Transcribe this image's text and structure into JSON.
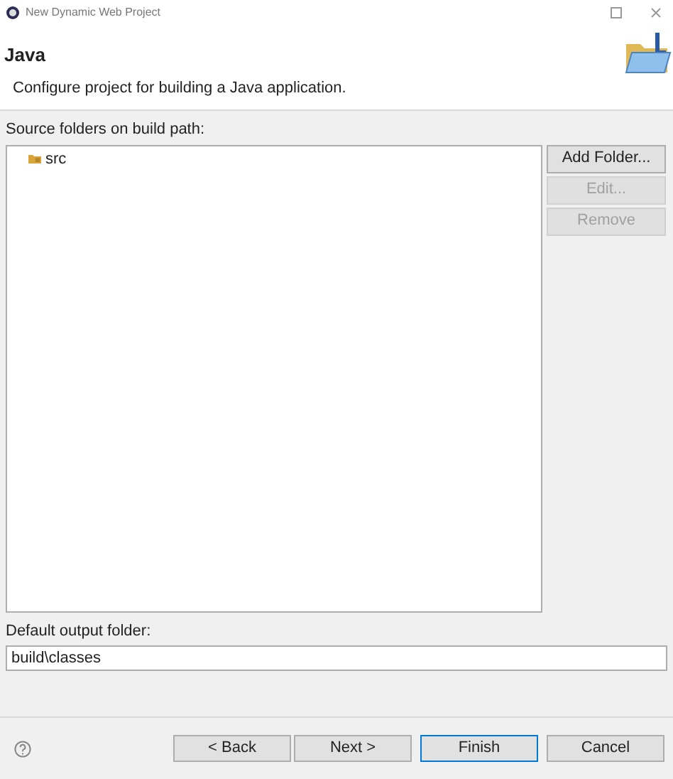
{
  "window": {
    "title": "New Dynamic Web Project"
  },
  "header": {
    "title": "Java",
    "description": "Configure project for building a Java application."
  },
  "source_folders": {
    "label": "Source folders on build path:",
    "items": [
      {
        "label": "src",
        "selected": false
      }
    ]
  },
  "side_buttons": [
    {
      "label": "Add Folder...",
      "disabled": false
    },
    {
      "label": "Edit...",
      "disabled": true
    },
    {
      "label": "Remove",
      "disabled": true
    }
  ],
  "output_folder": {
    "label": "Default output folder:",
    "value": "build\\classes"
  },
  "footer_buttons": [
    {
      "label": "< Back",
      "default": false
    },
    {
      "label": "Next >",
      "default": false
    },
    {
      "label": "Finish",
      "default": true
    },
    {
      "label": "Cancel",
      "default": false
    }
  ]
}
